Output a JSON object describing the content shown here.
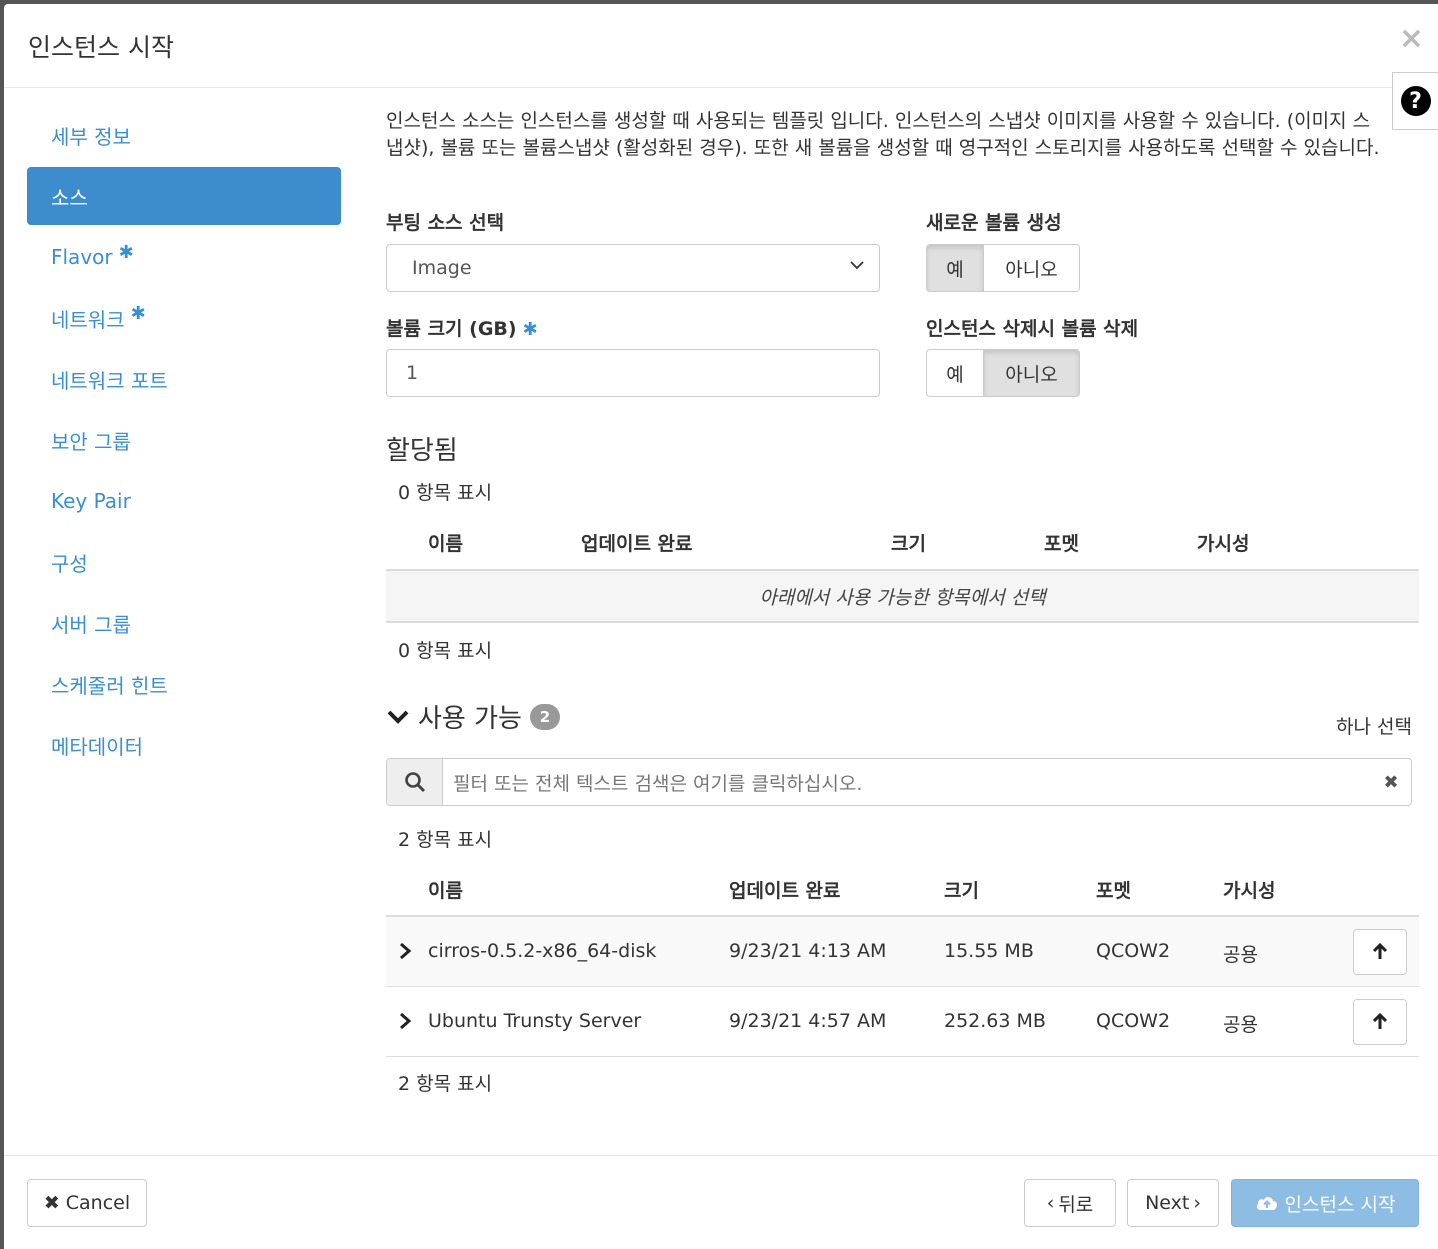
{
  "modal": {
    "title": "인스턴스 시작",
    "close": "×",
    "help": "?"
  },
  "nav": {
    "items": [
      {
        "label": "세부 정보",
        "required": false,
        "active": false
      },
      {
        "label": "소스",
        "required": false,
        "active": true
      },
      {
        "label": "Flavor",
        "required": true,
        "active": false
      },
      {
        "label": "네트워크",
        "required": true,
        "active": false
      },
      {
        "label": "네트워크 포트",
        "required": false,
        "active": false
      },
      {
        "label": "보안 그룹",
        "required": false,
        "active": false
      },
      {
        "label": "Key Pair",
        "required": false,
        "active": false
      },
      {
        "label": "구성",
        "required": false,
        "active": false
      },
      {
        "label": "서버 그룹",
        "required": false,
        "active": false
      },
      {
        "label": "스케줄러 힌트",
        "required": false,
        "active": false
      },
      {
        "label": "메타데이터",
        "required": false,
        "active": false
      }
    ],
    "required_mark": "✱"
  },
  "source": {
    "intro": "인스턴스 소스는 인스턴스를 생성할 때 사용되는 템플릿 입니다. 인스턴스의 스냅샷 이미지를 사용할 수 있습니다. (이미지 스냅샷), 볼륨 또는 볼륨스냅샷 (활성화된 경우). 또한 새 볼륨을 생성할 때 영구적인 스토리지를 사용하도록 선택할 수 있습니다.",
    "boot_source_label": "부팅 소스 선택",
    "boot_source_value": "Image",
    "create_volume_label": "새로운 볼륨 생성",
    "create_volume_yes": "예",
    "create_volume_no": "아니오",
    "create_volume_selected": "yes",
    "volume_size_label": "볼륨 크기 (GB)",
    "volume_size_value": "1",
    "delete_volume_label": "인스턴스 삭제시 볼륨 삭제",
    "delete_volume_yes": "예",
    "delete_volume_no": "아니오",
    "delete_volume_selected": "no"
  },
  "allocated": {
    "title": "할당됨",
    "count_top": "0 항목 표시",
    "count_bottom": "0 항목 표시",
    "columns": [
      "이름",
      "업데이트 완료",
      "크기",
      "포멧",
      "가시성"
    ],
    "empty_message": "아래에서 사용 가능한 항목에서 선택"
  },
  "available": {
    "title": "사용 가능",
    "badge": "2",
    "hint": "하나 선택",
    "search_placeholder": "필터 또는 전체 텍스트 검색은 여기를 클릭하십시오.",
    "count_top": "2 항목 표시",
    "count_bottom": "2 항목 표시",
    "columns": [
      "이름",
      "업데이트 완료",
      "크기",
      "포멧",
      "가시성"
    ],
    "rows": [
      {
        "name": "cirros-0.5.2-x86_64-disk",
        "updated": "9/23/21 4:13 AM",
        "size": "15.55 MB",
        "format": "QCOW2",
        "visibility": "공용"
      },
      {
        "name": "Ubuntu Trunsty Server",
        "updated": "9/23/21 4:57 AM",
        "size": "252.63 MB",
        "format": "QCOW2",
        "visibility": "공용"
      }
    ]
  },
  "footer": {
    "cancel": "Cancel",
    "back": "뒤로",
    "next": "Next",
    "launch": "인스턴스 시작"
  },
  "colors": {
    "accent": "#3d8ccd",
    "link": "#3a8fd1",
    "launch_disabled": "#8ebde3"
  }
}
